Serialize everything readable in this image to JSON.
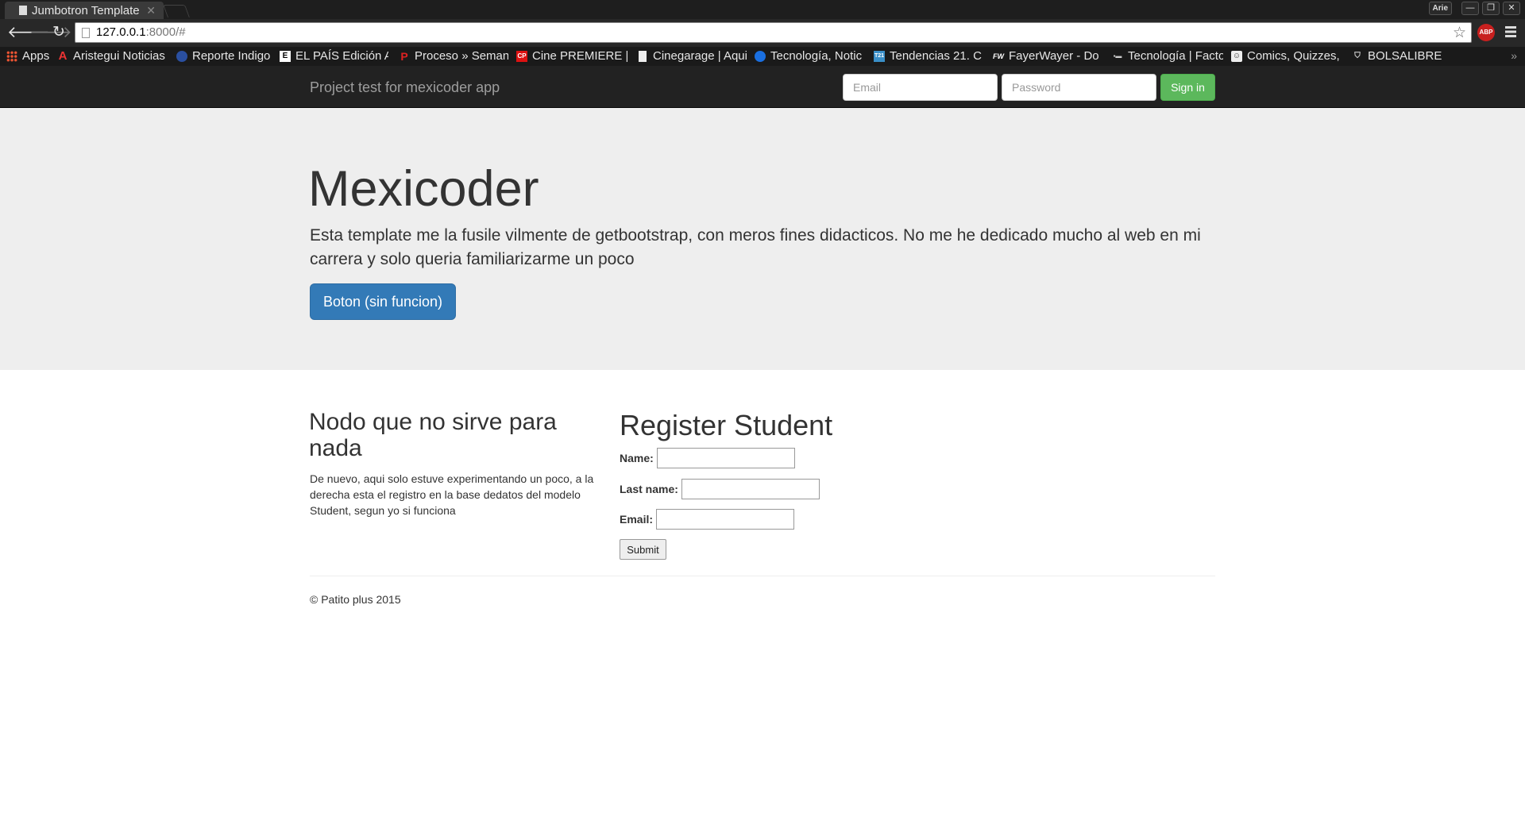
{
  "browser": {
    "tab_title": "Jumbotron Template",
    "user_label": "Arie",
    "url_host": "127.0.0.1",
    "url_rest": ":8000/#",
    "bookmarks": [
      {
        "label": "Apps",
        "icon": "apps-grid-icon"
      },
      {
        "label": "Aristegui Noticias",
        "icon": "aristegui-icon"
      },
      {
        "label": "Reporte Indigo",
        "icon": "reporte-indigo-icon"
      },
      {
        "label": "EL PAÍS Edición Ar",
        "icon": "el-pais-icon"
      },
      {
        "label": "Proceso » Semana",
        "icon": "proceso-icon"
      },
      {
        "label": "Cine PREMIERE | ",
        "icon": "cine-premiere-icon"
      },
      {
        "label": "Cinegarage | Aqui",
        "icon": "page-icon"
      },
      {
        "label": "Tecnología, Notic",
        "icon": "tecnologia-icon"
      },
      {
        "label": "Tendencias 21. C",
        "icon": "tendencias21-icon"
      },
      {
        "label": "FayerWayer - Do",
        "icon": "fayerwayer-icon"
      },
      {
        "label": "Tecnología | Facto",
        "icon": "facto-icon"
      },
      {
        "label": "Comics, Quizzes, ",
        "icon": "comics-icon"
      },
      {
        "label": "BOLSALIBRE",
        "icon": "bolsalibre-icon"
      }
    ],
    "more_label": "»"
  },
  "navbar": {
    "brand": "Project test for mexicoder app",
    "email_placeholder": "Email",
    "password_placeholder": "Password",
    "signin_label": "Sign in"
  },
  "jumbotron": {
    "title": "Mexicoder",
    "text": "Esta template me la fusile vilmente de getbootstrap, con meros fines didacticos. No me he dedicado mucho al web en mi carrera y solo queria familiarizarme un poco",
    "button_label": "Boton (sin funcion)"
  },
  "left": {
    "title": "Nodo que no sirve para nada",
    "text": "De nuevo, aqui solo estuve experimentando un poco, a la derecha esta el registro en la base dedatos del modelo Student, segun yo si funciona"
  },
  "register": {
    "title": "Register Student",
    "name_label": "Name:",
    "lastname_label": "Last name:",
    "email_label": "Email:",
    "submit_label": "Submit"
  },
  "footer": {
    "text": "© Patito plus 2015"
  },
  "colors": {
    "navbar_bg": "#222222",
    "jumbotron_bg": "#eeeeee",
    "primary": "#337ab7",
    "success": "#5cb85c"
  }
}
